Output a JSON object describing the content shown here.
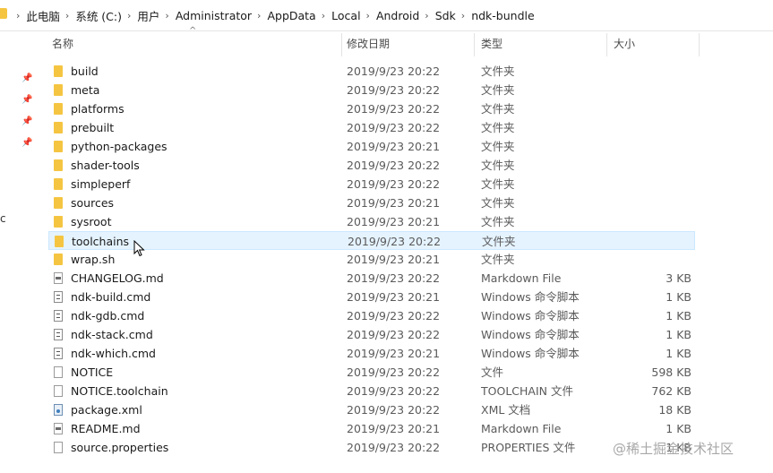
{
  "breadcrumb": [
    "此电脑",
    "系统 (C:)",
    "用户",
    "Administrator",
    "AppData",
    "Local",
    "Android",
    "Sdk",
    "ndk-bundle"
  ],
  "breadcrumb_separator": "›",
  "nav_edge_text": "c",
  "columns": {
    "name": "名称",
    "date": "修改日期",
    "type": "类型",
    "size": "大小"
  },
  "files": [
    {
      "name": "build",
      "date": "2019/9/23 20:22",
      "type": "文件夹",
      "size": "",
      "icon": "folder"
    },
    {
      "name": "meta",
      "date": "2019/9/23 20:22",
      "type": "文件夹",
      "size": "",
      "icon": "folder"
    },
    {
      "name": "platforms",
      "date": "2019/9/23 20:22",
      "type": "文件夹",
      "size": "",
      "icon": "folder"
    },
    {
      "name": "prebuilt",
      "date": "2019/9/23 20:22",
      "type": "文件夹",
      "size": "",
      "icon": "folder"
    },
    {
      "name": "python-packages",
      "date": "2019/9/23 20:21",
      "type": "文件夹",
      "size": "",
      "icon": "folder"
    },
    {
      "name": "shader-tools",
      "date": "2019/9/23 20:22",
      "type": "文件夹",
      "size": "",
      "icon": "folder"
    },
    {
      "name": "simpleperf",
      "date": "2019/9/23 20:22",
      "type": "文件夹",
      "size": "",
      "icon": "folder"
    },
    {
      "name": "sources",
      "date": "2019/9/23 20:21",
      "type": "文件夹",
      "size": "",
      "icon": "folder"
    },
    {
      "name": "sysroot",
      "date": "2019/9/23 20:21",
      "type": "文件夹",
      "size": "",
      "icon": "folder"
    },
    {
      "name": "toolchains",
      "date": "2019/9/23 20:22",
      "type": "文件夹",
      "size": "",
      "icon": "folder",
      "hover": true
    },
    {
      "name": "wrap.sh",
      "date": "2019/9/23 20:21",
      "type": "文件夹",
      "size": "",
      "icon": "folder"
    },
    {
      "name": "CHANGELOG.md",
      "date": "2019/9/23 20:22",
      "type": "Markdown File",
      "size": "3 KB",
      "icon": "md"
    },
    {
      "name": "ndk-build.cmd",
      "date": "2019/9/23 20:21",
      "type": "Windows 命令脚本",
      "size": "1 KB",
      "icon": "cmd"
    },
    {
      "name": "ndk-gdb.cmd",
      "date": "2019/9/23 20:22",
      "type": "Windows 命令脚本",
      "size": "1 KB",
      "icon": "cmd"
    },
    {
      "name": "ndk-stack.cmd",
      "date": "2019/9/23 20:22",
      "type": "Windows 命令脚本",
      "size": "1 KB",
      "icon": "cmd"
    },
    {
      "name": "ndk-which.cmd",
      "date": "2019/9/23 20:21",
      "type": "Windows 命令脚本",
      "size": "1 KB",
      "icon": "cmd"
    },
    {
      "name": "NOTICE",
      "date": "2019/9/23 20:22",
      "type": "文件",
      "size": "598 KB",
      "icon": "file"
    },
    {
      "name": "NOTICE.toolchain",
      "date": "2019/9/23 20:22",
      "type": "TOOLCHAIN 文件",
      "size": "762 KB",
      "icon": "file"
    },
    {
      "name": "package.xml",
      "date": "2019/9/23 20:22",
      "type": "XML 文档",
      "size": "18 KB",
      "icon": "xml"
    },
    {
      "name": "README.md",
      "date": "2019/9/23 20:21",
      "type": "Markdown File",
      "size": "1 KB",
      "icon": "md"
    },
    {
      "name": "source.properties",
      "date": "2019/9/23 20:22",
      "type": "PROPERTIES 文件",
      "size": "1 KB",
      "icon": "file"
    }
  ],
  "watermark": "@稀土掘金技术社区"
}
